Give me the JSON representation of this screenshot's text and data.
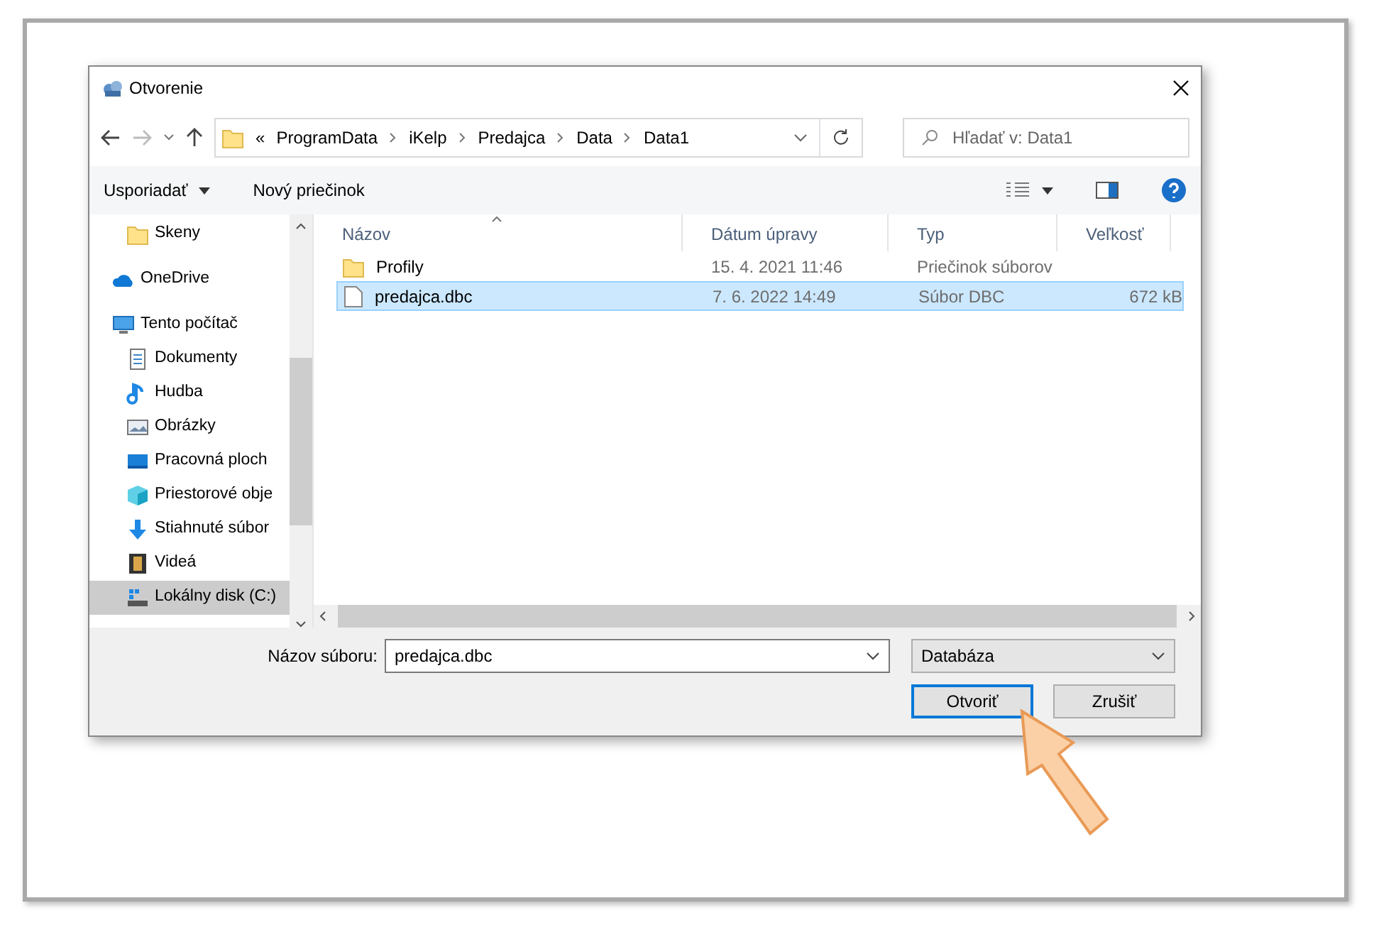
{
  "window": {
    "title": "Otvorenie"
  },
  "address": {
    "overflow": "«",
    "path": [
      "ProgramData",
      "iKelp",
      "Predajca",
      "Data",
      "Data1"
    ]
  },
  "search": {
    "placeholder": "Hľadať v: Data1"
  },
  "toolbar": {
    "organize": "Usporiadať",
    "new_folder": "Nový priečinok"
  },
  "sidebar": {
    "items": [
      {
        "label": "Skeny",
        "kind": "sub",
        "selected": false
      },
      {
        "label": "OneDrive",
        "kind": "root",
        "selected": false
      },
      {
        "label": "Tento počítač",
        "kind": "root",
        "selected": false,
        "children": [
          {
            "label": "Dokumenty",
            "selected": false
          },
          {
            "label": "Hudba",
            "selected": false
          },
          {
            "label": "Obrázky",
            "selected": false
          },
          {
            "label": "Pracovná ploch",
            "selected": false
          },
          {
            "label": "Priestorové obje",
            "selected": false
          },
          {
            "label": "Stiahnuté súbor",
            "selected": false
          },
          {
            "label": "Videá",
            "selected": false
          },
          {
            "label": "Lokálny disk (C:)",
            "selected": true
          }
        ]
      }
    ]
  },
  "table": {
    "columns": [
      "Názov",
      "Dátum úpravy",
      "Typ",
      "Veľkosť"
    ],
    "rows": [
      {
        "kind": "folder",
        "name": "Profily",
        "date": "15. 4. 2021 11:46",
        "type": "Priečinok súborov",
        "size": "",
        "selected": false
      },
      {
        "kind": "file",
        "name": "predajca.dbc",
        "date": "7. 6. 2022 14:49",
        "type": "Súbor DBC",
        "size": "672 kB",
        "selected": true
      }
    ]
  },
  "footer": {
    "filename_label": "Názov súboru:",
    "filename": "predajca.dbc",
    "filter": "Databáza",
    "open_button": "Otvoriť",
    "cancel_button": "Zrušiť"
  }
}
